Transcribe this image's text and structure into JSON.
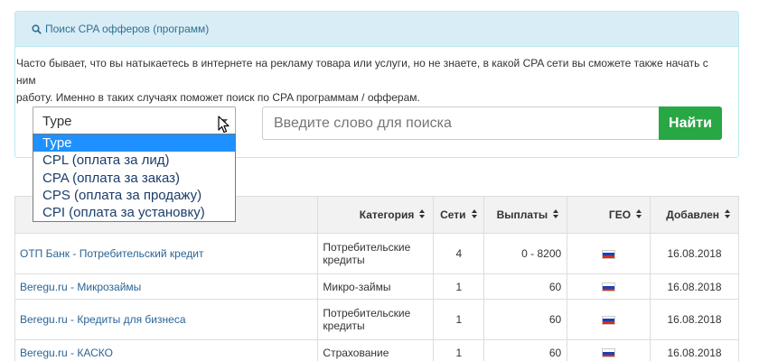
{
  "panel": {
    "title": "Поиск CPA офферов (программ)",
    "description_line1": "Часто бывает, что вы натыкаетесь в интернете на рекламу товара или услуги, но не знаете, в какой CPA сети вы сможете также начать с ним",
    "description_line2": "работу. Именно в таких случаях поможет поиск по CPA программам / офферам.",
    "type_select_value": "Type",
    "search_placeholder": "Введите слово для поиска",
    "search_button": "Найти"
  },
  "dropdown": {
    "options": [
      "Type",
      "CPL (оплата за лид)",
      "CPA (оплата за заказ)",
      "CPS (оплата за продажу)",
      "CPI (оплата за установку)"
    ],
    "highlighted": "Type"
  },
  "table": {
    "headers": [
      "",
      "Категория",
      "Сети",
      "Выплаты",
      "ГЕО",
      "Добавлен"
    ],
    "rows": [
      {
        "name": "ОТП Банк - Потребительский кредит",
        "category_line1": "Потребительские",
        "category_line2": "кредиты",
        "networks": "4",
        "payout": "0 - 8200",
        "date": "16.08.2018"
      },
      {
        "name": "Beregu.ru - Микрозаймы",
        "category_line1": "Микро-займы",
        "category_line2": "",
        "networks": "1",
        "payout": "60",
        "date": "16.08.2018"
      },
      {
        "name": "Beregu.ru - Кредиты для бизнеса",
        "category_line1": "Потребительские",
        "category_line2": "кредиты",
        "networks": "1",
        "payout": "60",
        "date": "16.08.2018"
      },
      {
        "name": "Beregu.ru - КАСКО",
        "category_line1": "Страхование",
        "category_line2": "",
        "networks": "1",
        "payout": "60",
        "date": "16.08.2018"
      }
    ]
  },
  "colors": {
    "panel_heading_bg": "#d9edf7",
    "search_button_bg": "#28a745",
    "link": "#2a6496",
    "dropdown_highlight": "#1e90ff"
  }
}
